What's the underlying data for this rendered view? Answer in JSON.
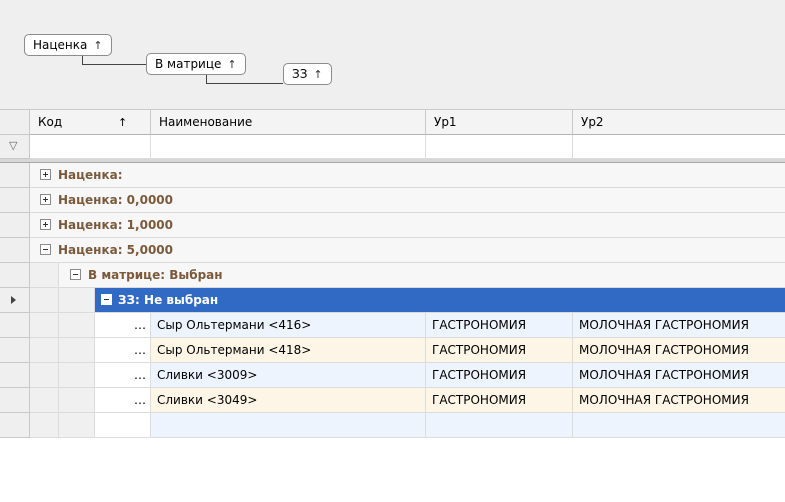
{
  "group_panel": {
    "chips": [
      {
        "label": "Наценка",
        "arrow": "↑"
      },
      {
        "label": "В матрице",
        "arrow": "↑"
      },
      {
        "label": "ЗЗ",
        "arrow": "↑"
      }
    ]
  },
  "columns": [
    {
      "label": "Код",
      "sort_arrow": "↑"
    },
    {
      "label": "Наименование"
    },
    {
      "label": "Ур1"
    },
    {
      "label": "Ур2"
    }
  ],
  "filter_icon": "funnel-icon",
  "groups": [
    {
      "text": "Наценка:",
      "state": "collapsed"
    },
    {
      "text": "Наценка: 0,0000",
      "state": "collapsed"
    },
    {
      "text": "Наценка: 1,0000",
      "state": "collapsed"
    },
    {
      "text": "Наценка: 5,0000",
      "state": "expanded"
    },
    {
      "text": "В матрице: Выбран",
      "state": "expanded"
    },
    {
      "text": "ЗЗ: Не выбран",
      "state": "expanded",
      "selected": true
    }
  ],
  "rows": [
    {
      "code": "…",
      "name": "Сыр Ольтермани  <416>",
      "ur1": "ГАСТРОНОМИЯ",
      "ur2": "МОЛОЧНАЯ ГАСТРОНОМИЯ"
    },
    {
      "code": "…",
      "name": "Сыр Ольтермани  <418>",
      "ur1": "ГАСТРОНОМИЯ",
      "ur2": "МОЛОЧНАЯ ГАСТРОНОМИЯ"
    },
    {
      "code": "…",
      "name": "Сливки  <3009>",
      "ur1": "ГАСТРОНОМИЯ",
      "ur2": "МОЛОЧНАЯ ГАСТРОНОМИЯ"
    },
    {
      "code": "…",
      "name": "Сливки  <3049>",
      "ur1": "ГАСТРОНОМИЯ",
      "ur2": "МОЛОЧНАЯ ГАСТРОНОМИЯ"
    }
  ],
  "colors": {
    "selection": "#316ac5",
    "group_text": "#7a5a3a"
  }
}
